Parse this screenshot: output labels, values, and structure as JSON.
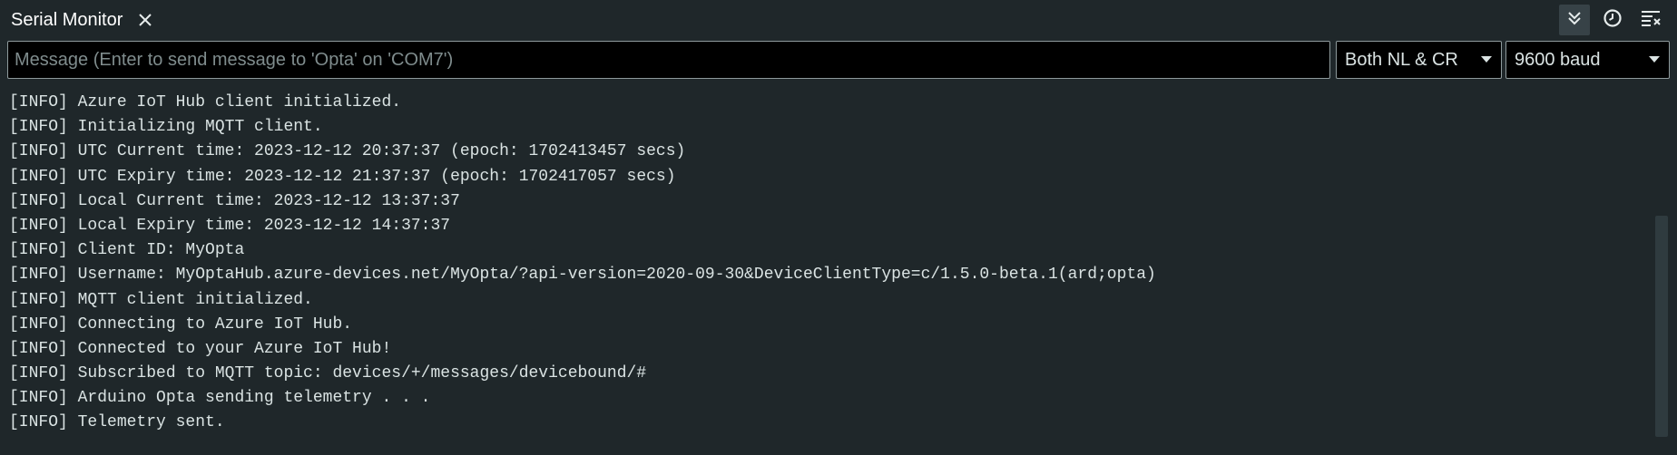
{
  "header": {
    "tab_title": "Serial Monitor",
    "icons": {
      "close": "close-icon",
      "autoscroll": "double-chevron-down-icon",
      "timestamp": "clock-icon",
      "clear": "clear-output-icon"
    }
  },
  "input": {
    "placeholder": "Message (Enter to send message to 'Opta' on 'COM7')",
    "value": ""
  },
  "line_ending": {
    "selected": "Both NL & CR"
  },
  "baud_rate": {
    "selected": "9600 baud"
  },
  "output": {
    "lines": [
      "[INFO] Azure IoT Hub client initialized.",
      "[INFO] Initializing MQTT client.",
      "[INFO] UTC Current time: 2023-12-12 20:37:37 (epoch: 1702413457 secs)",
      "[INFO] UTC Expiry time: 2023-12-12 21:37:37 (epoch: 1702417057 secs)",
      "[INFO] Local Current time: 2023-12-12 13:37:37",
      "[INFO] Local Expiry time: 2023-12-12 14:37:37",
      "[INFO] Client ID: MyOpta",
      "[INFO] Username: MyOptaHub.azure-devices.net/MyOpta/?api-version=2020-09-30&DeviceClientType=c/1.5.0-beta.1(ard;opta)",
      "[INFO] MQTT client initialized.",
      "[INFO] Connecting to Azure IoT Hub.",
      "[INFO] Connected to your Azure IoT Hub!",
      "[INFO] Subscribed to MQTT topic: devices/+/messages/devicebound/#",
      "[INFO] Arduino Opta sending telemetry . . .",
      "[INFO] Telemetry sent."
    ]
  },
  "colors": {
    "background": "#1f272a",
    "text": "#dae3e3",
    "input_background": "#000000",
    "border": "#8e9a9c",
    "active_button": "#374247"
  }
}
